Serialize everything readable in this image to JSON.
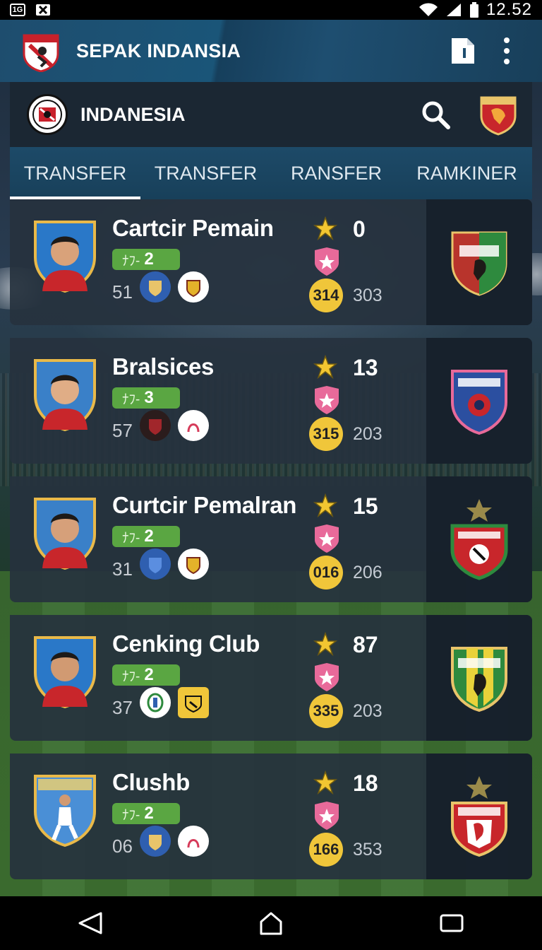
{
  "status_bar": {
    "left_icons": [
      "sim-icon",
      "apps-icon"
    ],
    "time": "12.52"
  },
  "app_bar": {
    "title": "SEPAK INDANSIA",
    "actions": [
      "document-icon",
      "more-vert-icon"
    ]
  },
  "league": {
    "name": "INDANESIA"
  },
  "tabs": [
    {
      "label": "TRANSFER",
      "active": true
    },
    {
      "label": "TRANSFER",
      "active": false
    },
    {
      "label": "RANSFER",
      "active": false
    },
    {
      "label": "RAMKINER",
      "active": false
    }
  ],
  "players": [
    {
      "name": "Cartcir Pemain",
      "position": "2",
      "number": "51",
      "rating": "0",
      "coins": "314",
      "secondary": "303"
    },
    {
      "name": "Bralsices",
      "position": "3",
      "number": "57",
      "rating": "13",
      "coins": "315",
      "secondary": "203"
    },
    {
      "name": "Curtcir Pemalran",
      "position": "2",
      "number": "31",
      "rating": "15",
      "coins": "016",
      "secondary": "206"
    },
    {
      "name": "Cenking Club",
      "position": "2",
      "number": "37",
      "rating": "87",
      "coins": "335",
      "secondary": "203"
    },
    {
      "name": "Clushb",
      "position": "2",
      "number": "06",
      "rating": "18",
      "coins": "166",
      "secondary": "353"
    }
  ],
  "colors": {
    "app_bar": "#1e4d6e",
    "card": "#26323e",
    "position_badge": "#5aa642",
    "coin": "#f0c63a",
    "star": "#f2c631",
    "heart": "#e86a9a"
  },
  "nav_bar": [
    "back-icon",
    "home-icon",
    "recents-icon"
  ]
}
